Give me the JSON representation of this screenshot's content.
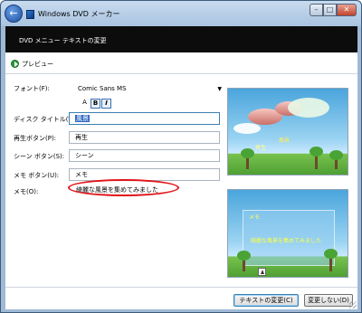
{
  "window": {
    "title": "Windows DVD メーカー",
    "controls": {
      "minimize": "–",
      "maximize": "□",
      "close": "✕"
    }
  },
  "header": {
    "title": "DVD メニュー テキストの変更"
  },
  "preview": {
    "label": "プレビュー"
  },
  "form": {
    "font": {
      "label": "フォント(F):",
      "value": "Comic Sans MS"
    },
    "style_buttons": {
      "a": "A",
      "bold": "B",
      "italic": "I"
    },
    "disc_title": {
      "label": "ディスク タイトル(T):",
      "value": "風景"
    },
    "play_button": {
      "label": "再生ボタン(P):",
      "value": "再生"
    },
    "scene_button": {
      "label": "シーン ボタン(S):",
      "value": "シーン"
    },
    "notes_button": {
      "label": "メモ ボタン(U):",
      "value": "メモ"
    },
    "notes": {
      "label": "メモ(O):",
      "value": "綺麗な風景を集めてみました"
    }
  },
  "previews": {
    "menu_title_text": "風景",
    "menu_play_text": "再生",
    "notes_preview_text": "綺麗な風景を集めてみました",
    "notes_preview_header": "メモ"
  },
  "footer": {
    "change_text": "テキストの変更(C)",
    "dont_change": "変更しない(D)"
  },
  "colors": {
    "header_bg": "#0c0c0c",
    "annotation": "#e0141a",
    "accent": "#316ac5"
  }
}
